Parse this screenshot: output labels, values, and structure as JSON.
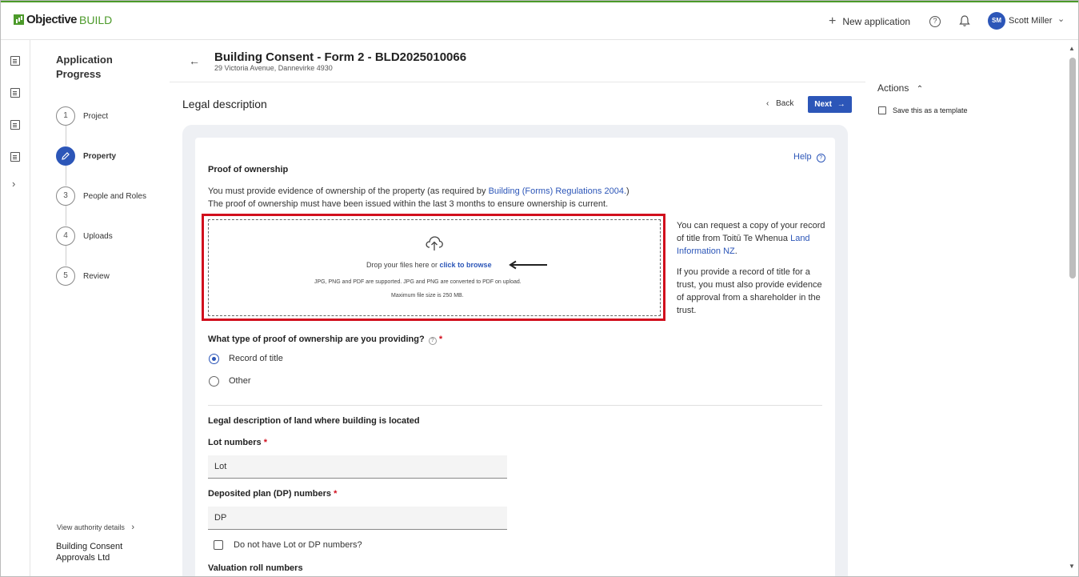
{
  "header": {
    "logo_main": "Objective",
    "logo_accent": "BUILD",
    "new_application_label": "New application",
    "help_icon": "question-circle-icon",
    "bell_icon": "bell-icon",
    "user_initials": "SM",
    "user_name": "Scott Miller",
    "accent_color": "#4c9a2a",
    "brand_color": "#2c56b8"
  },
  "left_rail": {
    "icons": [
      "dashboard-icon",
      "forms-icon",
      "documents-icon",
      "reports-icon",
      "expand-chevron-icon"
    ]
  },
  "progress": {
    "title": "Application Progress",
    "steps": [
      {
        "number": "1",
        "label": "Project",
        "state": "done"
      },
      {
        "number": "",
        "label": "Property",
        "state": "active",
        "icon": "pencil-icon"
      },
      {
        "number": "3",
        "label": "People and Roles",
        "state": "pending"
      },
      {
        "number": "4",
        "label": "Uploads",
        "state": "pending"
      },
      {
        "number": "5",
        "label": "Review",
        "state": "pending"
      }
    ],
    "authority_link": "View authority details",
    "authority_name": "Building Consent Approvals Ltd"
  },
  "page": {
    "title": "Building Consent - Form 2 - BLD2025010066",
    "address": "29 Victoria Avenue, Dannevirke 4930",
    "section_title": "Legal description",
    "back_label": "Back",
    "next_label": "Next"
  },
  "actions": {
    "title": "Actions",
    "save_template": "Save this as a template"
  },
  "form": {
    "help_label": "Help",
    "ownership_heading": "Proof of ownership",
    "ownership_text_1a": "You must provide evidence of ownership of the property (as required by ",
    "ownership_link": "Building (Forms) Regulations 2004.",
    "ownership_text_1b": ")",
    "ownership_text_2": "The proof of ownership must have been issued within the last 3 months to ensure ownership is current.",
    "drop_text": "Drop your files here or ",
    "drop_link": "click to browse",
    "drop_supported": "JPG, PNG and PDF are supported. JPG and PNG are converted to PDF on upload.",
    "drop_max": "Maximum file size is 250 MB.",
    "side_1a": "You can request a copy of your record of title from ",
    "side_1_org": "Toitū Te Whenua",
    "side_1_link": "Land Information NZ",
    "side_1b": ".",
    "side_2": "If you provide a record of title for a trust, you must also provide evidence of approval from a shareholder in the trust.",
    "proof_question": "What type of proof of ownership are you providing?",
    "proof_options": [
      {
        "label": "Record of title",
        "selected": true
      },
      {
        "label": "Other",
        "selected": false
      }
    ],
    "legal_heading": "Legal description of land where building is located",
    "lot_label": "Lot numbers",
    "lot_value": "Lot",
    "dp_label": "Deposited plan (DP) numbers",
    "dp_value": "DP",
    "no_lot_label": "Do not have Lot or DP numbers?",
    "valuation_label": "Valuation roll numbers",
    "required_mark": "*"
  }
}
